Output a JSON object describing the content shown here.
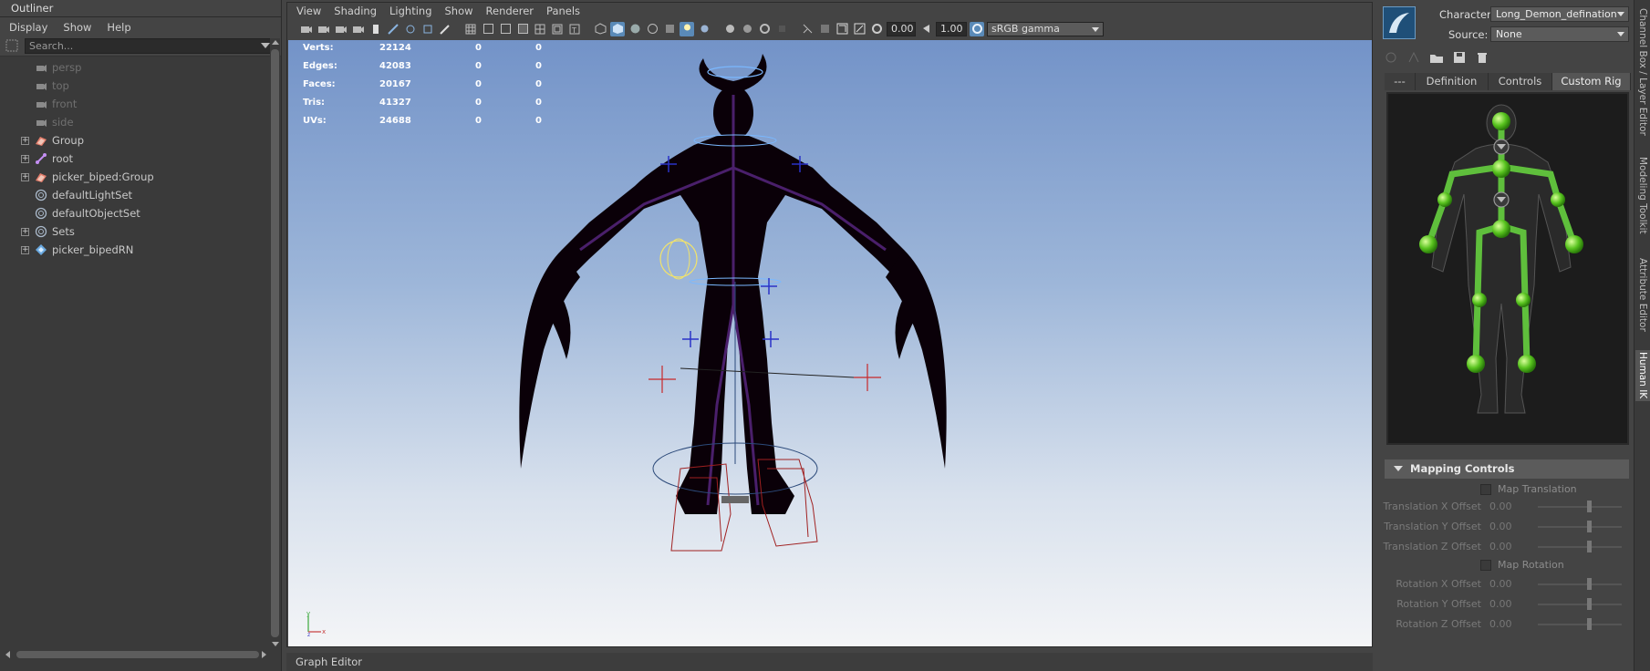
{
  "outliner": {
    "title": "Outliner",
    "menu": [
      "Display",
      "Show",
      "Help"
    ],
    "search_placeholder": "Search...",
    "items": [
      {
        "label": "persp",
        "icon": "camera-icon",
        "dim": true,
        "expand": false
      },
      {
        "label": "top",
        "icon": "camera-icon",
        "dim": true,
        "expand": false
      },
      {
        "label": "front",
        "icon": "camera-icon",
        "dim": true,
        "expand": false
      },
      {
        "label": "side",
        "icon": "camera-icon",
        "dim": true,
        "expand": false
      },
      {
        "label": "Group",
        "icon": "group-icon",
        "dim": false,
        "expand": true
      },
      {
        "label": "root",
        "icon": "joint-icon",
        "dim": false,
        "expand": true
      },
      {
        "label": "picker_biped:Group",
        "icon": "group-icon",
        "dim": false,
        "expand": true
      },
      {
        "label": "defaultLightSet",
        "icon": "set-icon",
        "dim": false,
        "expand": false
      },
      {
        "label": "defaultObjectSet",
        "icon": "set-icon",
        "dim": false,
        "expand": false
      },
      {
        "label": "Sets",
        "icon": "set-icon",
        "dim": false,
        "expand": true
      },
      {
        "label": "picker_bipedRN",
        "icon": "reference-icon",
        "dim": false,
        "expand": true
      }
    ]
  },
  "viewport": {
    "menu": [
      "View",
      "Shading",
      "Lighting",
      "Show",
      "Renderer",
      "Panels"
    ],
    "toolbar": {
      "exposure": "0.00",
      "gamma": "1.00",
      "color_space": "sRGB gamma"
    },
    "hud": [
      {
        "label": "Verts:",
        "a": "22124",
        "b": "0",
        "c": "0"
      },
      {
        "label": "Edges:",
        "a": "42083",
        "b": "0",
        "c": "0"
      },
      {
        "label": "Faces:",
        "a": "20167",
        "b": "0",
        "c": "0"
      },
      {
        "label": "Tris:",
        "a": "41327",
        "b": "0",
        "c": "0"
      },
      {
        "label": "UVs:",
        "a": "24688",
        "b": "0",
        "c": "0"
      }
    ],
    "axis": {
      "y": "y",
      "x": "x",
      "z": "z"
    }
  },
  "graph_editor_tab": "Graph Editor",
  "humanik": {
    "character_label": "Character:",
    "character_value": "Long_Demon_defination",
    "source_label": "Source:",
    "source_value": "None",
    "tabs": [
      "---",
      "Definition",
      "Controls",
      "Custom Rig"
    ],
    "active_tab": "Custom Rig",
    "mapping_header": "Mapping Controls",
    "map_translation": "Map Translation",
    "map_rotation": "Map Rotation",
    "translation_rows": [
      {
        "label": "Translation X Offset",
        "value": "0.00"
      },
      {
        "label": "Translation Y Offset",
        "value": "0.00"
      },
      {
        "label": "Translation Z Offset",
        "value": "0.00"
      }
    ],
    "rotation_rows": [
      {
        "label": "Rotation X Offset",
        "value": "0.00"
      },
      {
        "label": "Rotation Y Offset",
        "value": "0.00"
      },
      {
        "label": "Rotation Z Offset",
        "value": "0.00"
      }
    ],
    "accent_green": "#5fbf3c"
  },
  "side_tabs": [
    "Channel Box / Layer Editor",
    "Modeling Toolkit",
    "Attribute Editor",
    "Human IK"
  ]
}
